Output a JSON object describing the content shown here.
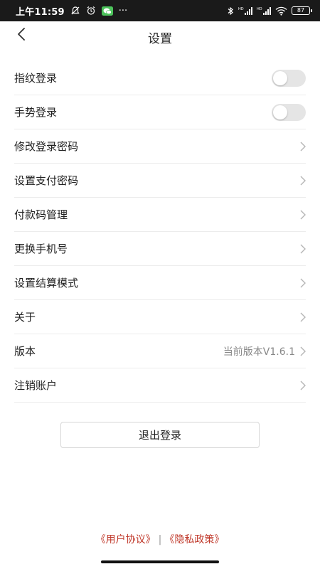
{
  "status_bar": {
    "time": "上午11:59",
    "icons_left": [
      "muted-bell-icon",
      "alarm-icon",
      "wechat-icon",
      "more-dots-icon"
    ],
    "icons_right": [
      "bluetooth-icon",
      "signal-hd-icon",
      "signal-hd-icon",
      "wifi-icon",
      "battery-icon"
    ],
    "signal_label": "HD",
    "battery_level": "87",
    "more_dots": "···"
  },
  "header": {
    "title": "设置",
    "back_icon": "chevron-left-icon"
  },
  "settings": [
    {
      "label": "指纹登录",
      "type": "toggle",
      "on": false
    },
    {
      "label": "手势登录",
      "type": "toggle",
      "on": false
    },
    {
      "label": "修改登录密码",
      "type": "link"
    },
    {
      "label": "设置支付密码",
      "type": "link"
    },
    {
      "label": "付款码管理",
      "type": "link"
    },
    {
      "label": "更换手机号",
      "type": "link"
    },
    {
      "label": "设置结算模式",
      "type": "link"
    },
    {
      "label": "关于",
      "type": "link"
    },
    {
      "label": "版本",
      "type": "link",
      "value": "当前版本V1.6.1"
    },
    {
      "label": "注销账户",
      "type": "link"
    }
  ],
  "logout_button": "退出登录",
  "footer": {
    "user_agreement": "《用户协议》",
    "separator": "|",
    "privacy_policy": "《隐私政策》"
  },
  "colors": {
    "status_bar_bg": "#1a1a1a",
    "accent_link": "#c0392b",
    "toggle_off": "#e5e5e5",
    "divider": "#ececec"
  }
}
